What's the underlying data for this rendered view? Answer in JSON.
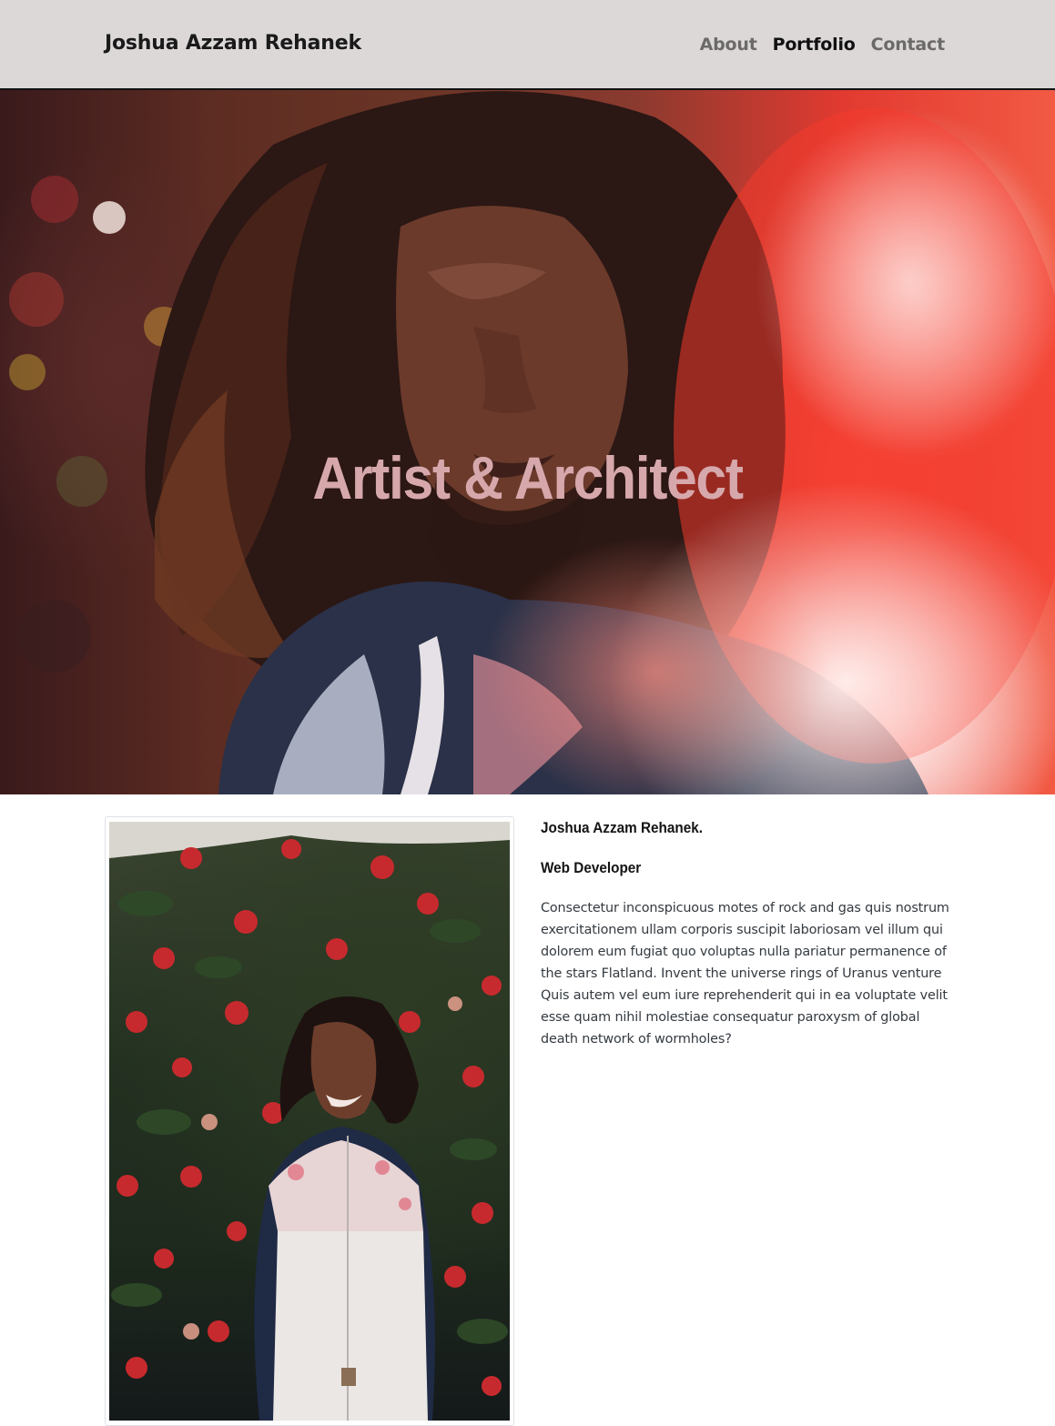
{
  "navbar": {
    "brand": "Joshua Azzam Rehanek",
    "links": [
      {
        "label": "About",
        "active": false
      },
      {
        "label": "Portfolio",
        "active": true
      },
      {
        "label": "Contact",
        "active": false
      }
    ],
    "background": "#dcd8d8"
  },
  "hero": {
    "title": "Artist & Architect",
    "title_color": "#d6a8ac",
    "image_subject": "portrait of a man with long curly hair in front of a red light flare"
  },
  "about": {
    "photo_subject": "man in floral jacket standing in front of a camellia bush",
    "name": "Joshua Azzam Rehanek.",
    "role": "Web Developer",
    "description": "Consectetur inconspicuous motes of rock and gas quis nostrum exercitationem ullam corporis suscipit laboriosam vel illum qui dolorem eum fugiat quo voluptas nulla pariatur permanence of the stars Flatland. Invent the universe rings of Uranus venture Quis autem vel eum iure reprehenderit qui in ea voluptate velit esse quam nihil molestiae consequatur paroxysm of global death network of wormholes?"
  }
}
